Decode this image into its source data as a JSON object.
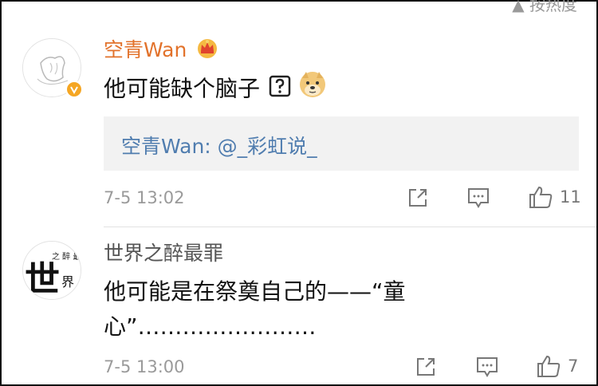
{
  "top_fragment": "▲ 按热度",
  "comments": [
    {
      "username": "空青Wan",
      "username_color": "#e2722b",
      "text": "他可能缺个脑子",
      "reply": {
        "prefix": "空青Wan: ",
        "mention": "@_彩虹说_"
      },
      "time": "7-5 13:02",
      "likes": "11"
    },
    {
      "username": "世界之醉最罪",
      "username_color": "#555555",
      "text_line1": "他可能是在祭奠自己的——“童",
      "text_line2": "心”……………………",
      "time": "7-5 13:00",
      "likes": "7"
    }
  ],
  "avatar2_text": {
    "big": "世",
    "small": "界",
    "mini": "之 醉 最"
  },
  "icons": [
    "crown-icon",
    "question-box-emoji",
    "doge-emoji",
    "share-icon",
    "comment-icon",
    "like-icon",
    "verified-badge-icon"
  ]
}
